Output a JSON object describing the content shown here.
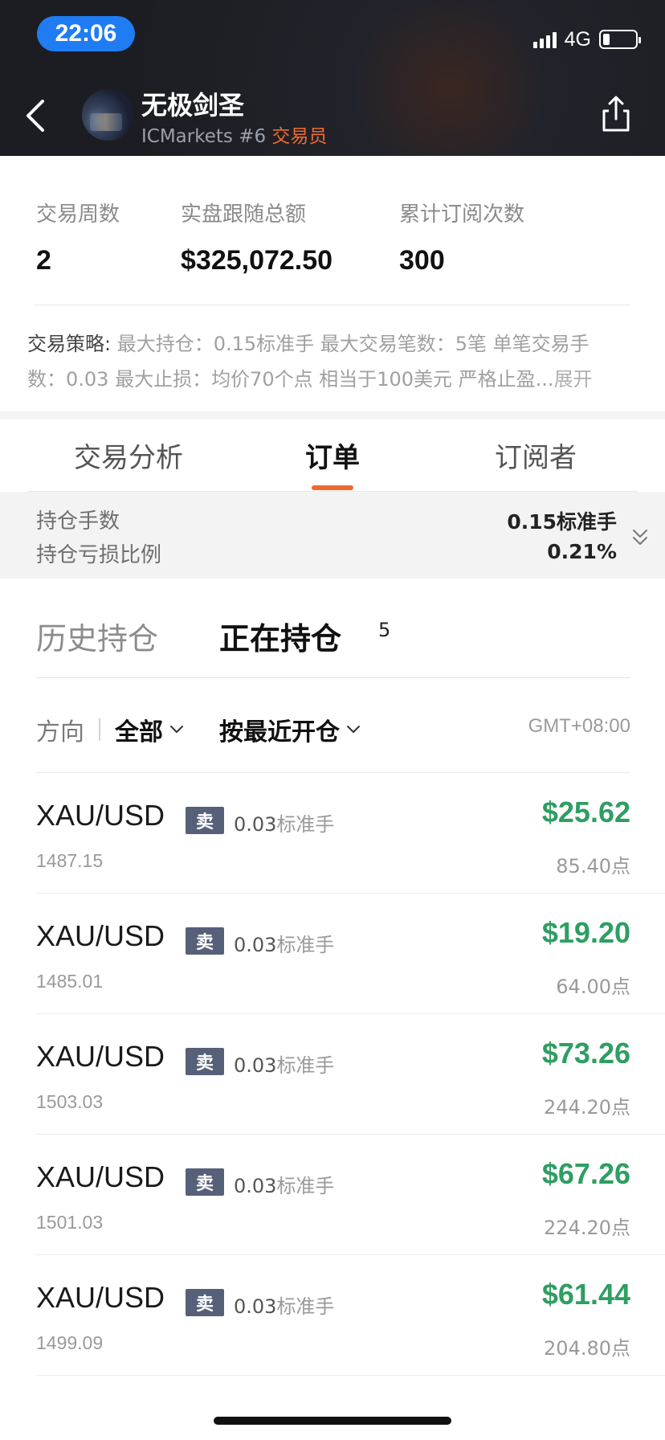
{
  "status_bar": {
    "time": "22:06",
    "network": "4G",
    "battery_level": 0.2
  },
  "header": {
    "trader_name": "无极剑圣",
    "broker": "ICMarkets #6",
    "role": "交易员"
  },
  "stats": [
    {
      "label": "交易周数",
      "value": "2"
    },
    {
      "label": "实盘跟随总额",
      "value": "$325,072.50"
    },
    {
      "label": "累计订阅次数",
      "value": "300"
    }
  ],
  "strategy": {
    "key": "交易策略:",
    "line1": " 最大持仓：0.15标准手 最大交易笔数：5笔 单笔交易手",
    "line2": "数：0.03 最大止损：均价70个点 相当于100美元 严格止盈...",
    "more": "展开"
  },
  "tabs": [
    {
      "label": "交易分析"
    },
    {
      "label": "订单"
    },
    {
      "label": "订阅者"
    }
  ],
  "summary": {
    "lots_label": "持仓手数",
    "lots_value": "0.15标准手",
    "loss_label": "持仓亏损比例",
    "loss_value": "0.21%"
  },
  "position_tabs": {
    "history": "历史持仓",
    "open": "正在持仓",
    "open_count": "5"
  },
  "filters": {
    "direction_key": "方向",
    "direction_value": "全部",
    "sort": "按最近开仓",
    "timezone": "GMT+08:00"
  },
  "positions": [
    {
      "symbol": "XAU/USD",
      "side": "卖",
      "lots": "0.03",
      "lot_unit": "标准手",
      "open_price": "1487.15",
      "profit": "$25.62",
      "points": "85.40点"
    },
    {
      "symbol": "XAU/USD",
      "side": "卖",
      "lots": "0.03",
      "lot_unit": "标准手",
      "open_price": "1485.01",
      "profit": "$19.20",
      "points": "64.00点"
    },
    {
      "symbol": "XAU/USD",
      "side": "卖",
      "lots": "0.03",
      "lot_unit": "标准手",
      "open_price": "1503.03",
      "profit": "$73.26",
      "points": "244.20点"
    },
    {
      "symbol": "XAU/USD",
      "side": "卖",
      "lots": "0.03",
      "lot_unit": "标准手",
      "open_price": "1501.03",
      "profit": "$67.26",
      "points": "224.20点"
    },
    {
      "symbol": "XAU/USD",
      "side": "卖",
      "lots": "0.03",
      "lot_unit": "标准手",
      "open_price": "1499.09",
      "profit": "$61.44",
      "points": "204.80点"
    }
  ],
  "colors": {
    "accent": "#ee6a2f",
    "profit": "#2e9e62",
    "badge": "#576079"
  },
  "icons": {
    "back": "chevron-left-icon",
    "share": "share-icon",
    "expand": "double-chevron-down-icon",
    "dropdown": "chevron-down-icon"
  }
}
